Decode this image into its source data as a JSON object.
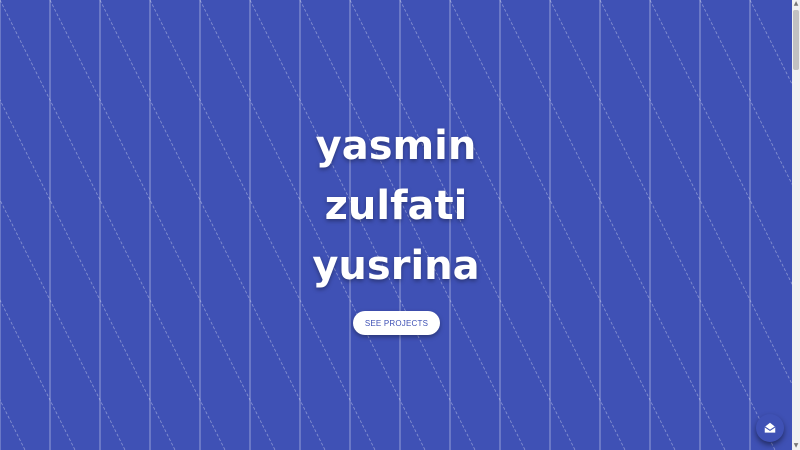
{
  "theme": {
    "background": "#3f51b5",
    "text": "#ffffff",
    "button_bg": "#ffffff",
    "button_text": "#3f51b5",
    "pattern_line": "#ffffff"
  },
  "hero": {
    "name_lines": [
      "yasmin",
      "zulfati",
      "yusrina"
    ],
    "cta_label": "SEE PROJECTS"
  },
  "fab": {
    "icon": "mail-open-icon"
  },
  "scrollbar": {
    "up_icon": "▲",
    "down_icon": "▼"
  }
}
